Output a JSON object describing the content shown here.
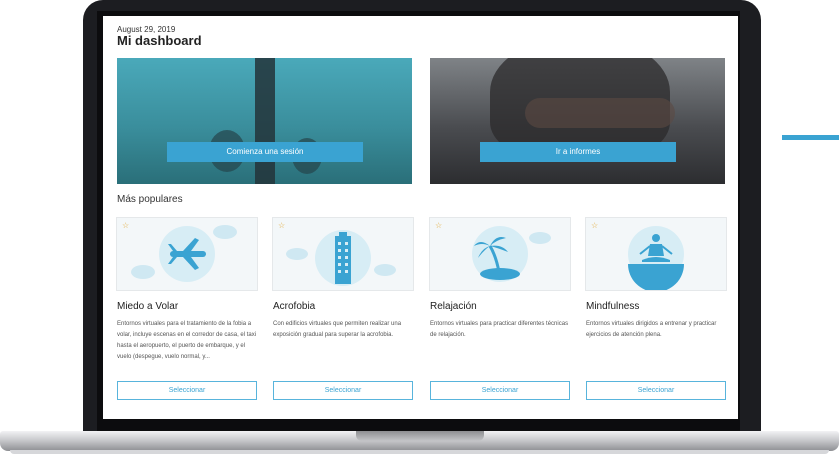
{
  "dashboard": {
    "date": "August 29, 2019",
    "title": "Mi dashboard"
  },
  "hero": [
    {
      "button_label": "Comienza una sesión"
    },
    {
      "button_label": "Ir a informes"
    }
  ],
  "popular": {
    "heading": "Más populares",
    "cards": [
      {
        "title": "Miedo a Volar",
        "description": "Entornos virtuales para el tratamiento de la fobia a volar, incluye escenas en el corredor de casa, el taxi hasta el aeropuerto, el puerto de embarque, y el vuelo (despegue, vuelo normal, y...",
        "button_label": "Seleccionar",
        "icon": "airplane-icon"
      },
      {
        "title": "Acrofobia",
        "description": "Con edificios virtuales que permiten realizar una exposición gradual para superar la acrofobia.",
        "button_label": "Seleccionar",
        "icon": "building-icon"
      },
      {
        "title": "Relajación",
        "description": "Entornos virtuales para practicar diferentes técnicas de relajación.",
        "button_label": "Seleccionar",
        "icon": "palm-tree-icon"
      },
      {
        "title": "Mindfulness",
        "description": "Entornos virtuales dirigidos a entrenar y practicar ejercicios de atención plena.",
        "button_label": "Seleccionar",
        "icon": "meditation-icon"
      }
    ]
  },
  "colors": {
    "accent": "#3aa3d2",
    "star": "#e2a833",
    "frame": "#1c1d21",
    "annotation": "#2f4a63"
  }
}
